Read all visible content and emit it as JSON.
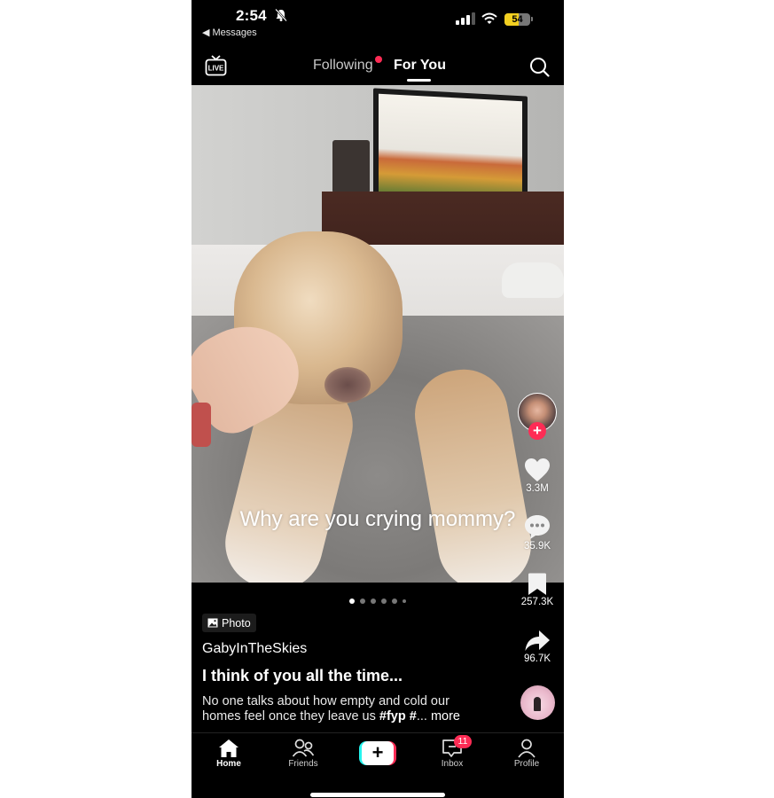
{
  "status_bar": {
    "time": "2:54",
    "back_app": "◀ Messages",
    "battery_level": 54,
    "battery_text": "54",
    "icons": [
      "bell-slash-icon",
      "cellular-signal-icon",
      "wifi-icon",
      "battery-icon"
    ]
  },
  "top_nav": {
    "live_label": "LIVE",
    "tabs": [
      {
        "label": "Following",
        "active": false,
        "has_dot": true
      },
      {
        "label": "For You",
        "active": true
      }
    ],
    "icons": [
      "live-tv-icon",
      "search-icon"
    ]
  },
  "post": {
    "overlay_text": "Why are you crying mommy?",
    "slide_count": 6,
    "current_slide": 1,
    "media_badge": "Photo",
    "username": "GabyInTheSkies",
    "title": "I think of you all the time...",
    "caption_prefix": "No one talks about how empty and cold our homes feel once they leave us ",
    "caption_hashtags": "#fyp #",
    "caption_ellipsis": "...",
    "caption_more": " more"
  },
  "actions": {
    "likes": "3.3M",
    "comments": "35.9K",
    "saves": "257.3K",
    "shares": "96.7K",
    "follow_symbol": "+"
  },
  "colors": {
    "accent": "#fe2c55",
    "cyan": "#25f4ee",
    "battery_yellow": "#f2cf20"
  },
  "bottom_nav": {
    "items": [
      {
        "label": "Home",
        "icon": "home-icon",
        "active": true
      },
      {
        "label": "Friends",
        "icon": "friends-icon"
      },
      {
        "label": "",
        "icon": "create-plus-icon"
      },
      {
        "label": "Inbox",
        "icon": "inbox-icon",
        "badge": "11"
      },
      {
        "label": "Profile",
        "icon": "profile-icon"
      }
    ],
    "create_symbol": "+"
  }
}
